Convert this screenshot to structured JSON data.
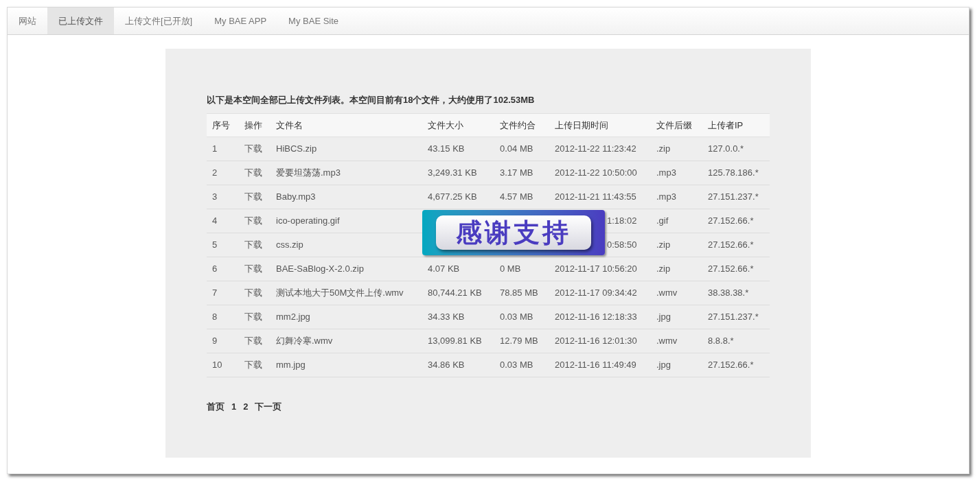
{
  "nav": {
    "tabs": [
      {
        "label": "网站",
        "selected": false
      },
      {
        "label": "已上传文件",
        "selected": true
      },
      {
        "label": "上传文件[已开放]",
        "selected": false
      },
      {
        "label": "My BAE APP",
        "selected": false
      },
      {
        "label": "My BAE Site",
        "selected": false
      }
    ]
  },
  "summary": "以下是本空间全部已上传文件列表。本空间目前有18个文件，大约使用了102.53MB",
  "table": {
    "columns": [
      "序号",
      "操作",
      "文件名",
      "文件大小",
      "文件约合",
      "上传日期时间",
      "文件后缀",
      "上传者IP"
    ],
    "rows": [
      {
        "covered": false,
        "cells": [
          "1",
          "下载",
          "HiBCS.zip",
          "43.15 KB",
          "0.04 MB",
          "2012-11-22 11:23:42",
          ".zip",
          "127.0.0.*"
        ]
      },
      {
        "covered": false,
        "cells": [
          "2",
          "下载",
          "爱要坦荡荡.mp3",
          "3,249.31 KB",
          "3.17 MB",
          "2012-11-22 10:50:00",
          ".mp3",
          "125.78.186.*"
        ]
      },
      {
        "covered": false,
        "cells": [
          "3",
          "下载",
          "Baby.mp3",
          "4,677.25 KB",
          "4.57 MB",
          "2012-11-21 11:43:55",
          ".mp3",
          "27.151.237.*"
        ]
      },
      {
        "covered": true,
        "cells": [
          "4",
          "下载",
          "ico-operating.gif",
          null,
          null,
          "1:18:02",
          ".gif",
          "27.152.66.*"
        ]
      },
      {
        "covered": true,
        "cells": [
          "5",
          "下载",
          "css.zip",
          null,
          null,
          "0:58:50",
          ".zip",
          "27.152.66.*"
        ]
      },
      {
        "covered": false,
        "cells": [
          "6",
          "下载",
          "BAE-SaBlog-X-2.0.zip",
          "4.07 KB",
          "0 MB",
          "2012-11-17 10:56:20",
          ".zip",
          "27.152.66.*"
        ]
      },
      {
        "covered": false,
        "cells": [
          "7",
          "下载",
          "测试本地大于50M文件上传.wmv",
          "80,744.21 KB",
          "78.85 MB",
          "2012-11-17 09:34:42",
          ".wmv",
          "38.38.38.*"
        ]
      },
      {
        "covered": false,
        "cells": [
          "8",
          "下载",
          "mm2.jpg",
          "34.33 KB",
          "0.03 MB",
          "2012-11-16 12:18:33",
          ".jpg",
          "27.151.237.*"
        ]
      },
      {
        "covered": false,
        "cells": [
          "9",
          "下载",
          "幻舞冷寒.wmv",
          "13,099.81 KB",
          "12.79 MB",
          "2012-11-16 12:01:30",
          ".wmv",
          "8.8.8.*"
        ]
      },
      {
        "covered": false,
        "cells": [
          "10",
          "下载",
          "mm.jpg",
          "34.86 KB",
          "0.03 MB",
          "2012-11-16 11:49:49",
          ".jpg",
          "27.152.66.*"
        ]
      }
    ]
  },
  "pagination": [
    {
      "label": "首页"
    },
    {
      "label": "1"
    },
    {
      "label": "2"
    },
    {
      "label": "下一页"
    }
  ],
  "overlay": {
    "text": "感谢支持"
  }
}
